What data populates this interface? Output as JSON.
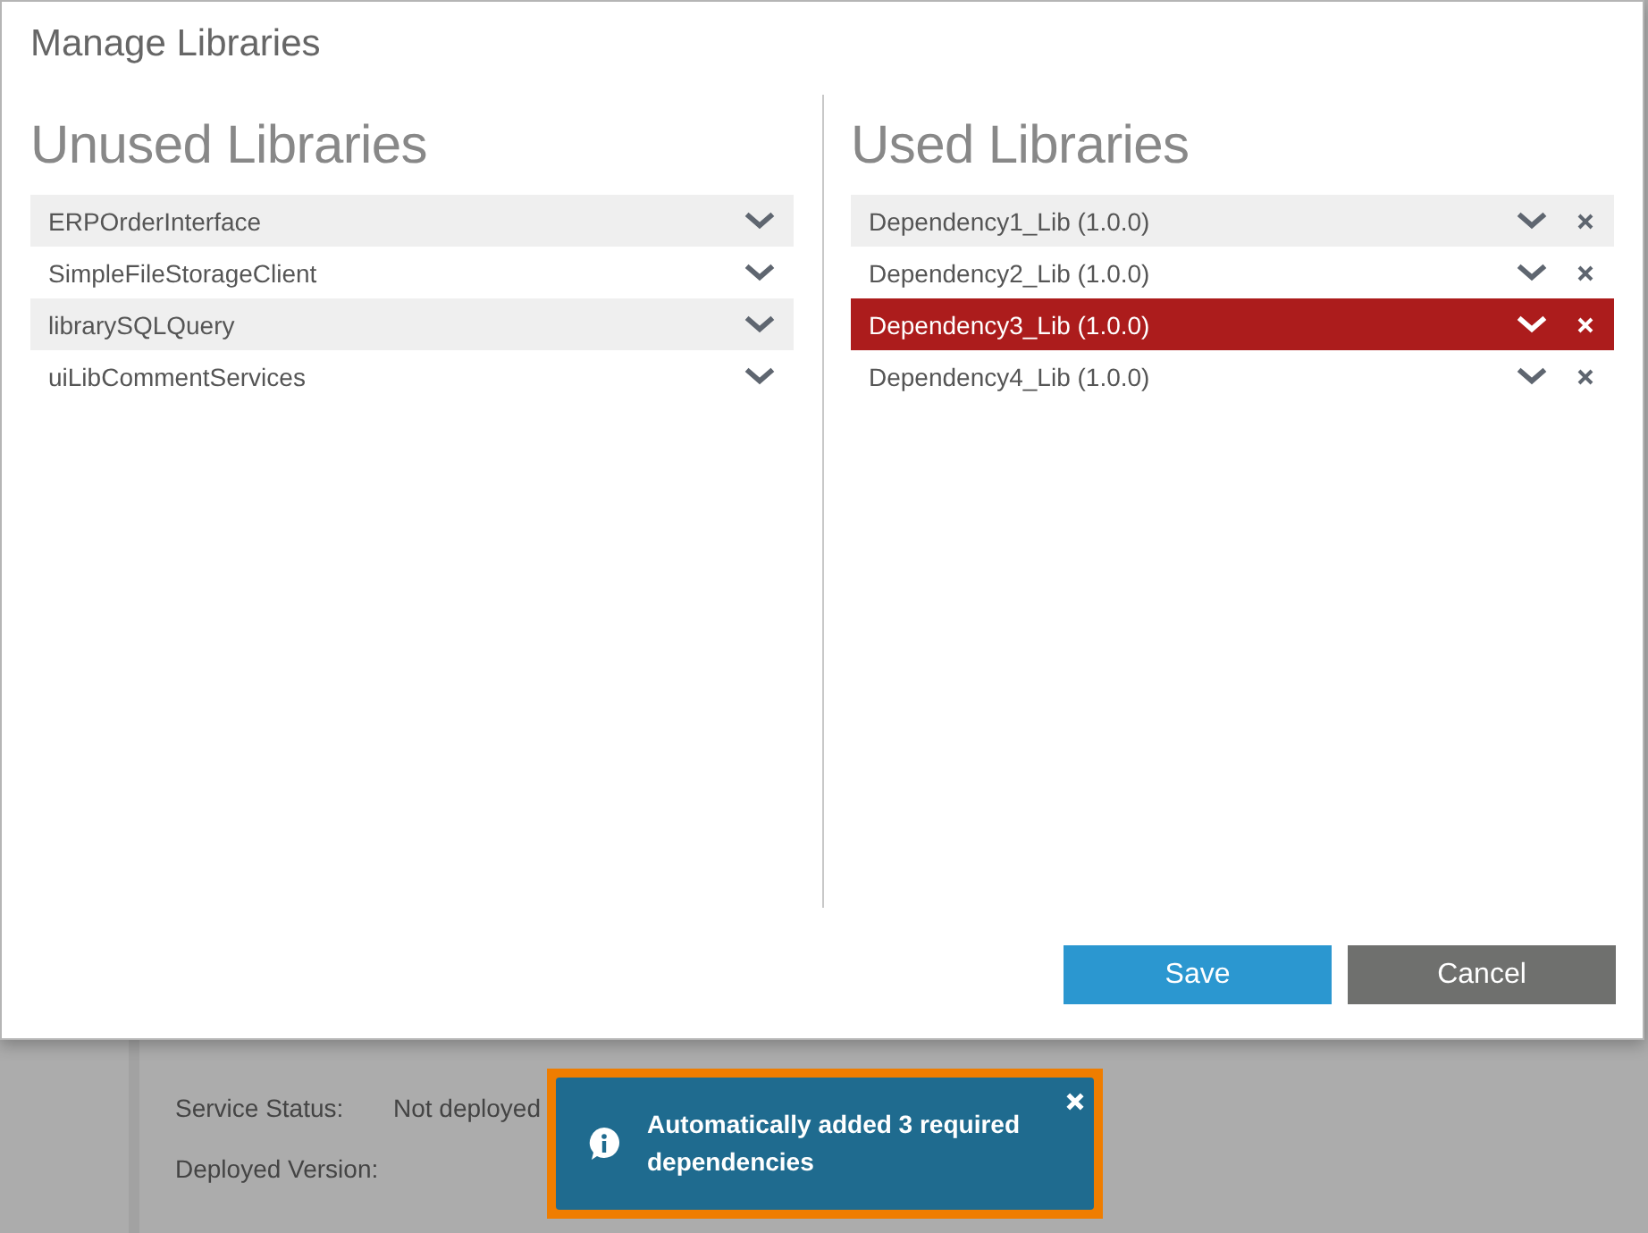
{
  "background": {
    "fields": [
      {
        "label": "Service Status:",
        "value": "Not deployed"
      },
      {
        "label": "Deployed Version:"
      }
    ]
  },
  "dialog": {
    "title": "Manage Libraries",
    "unused": {
      "heading": "Unused Libraries",
      "items": [
        {
          "name": "ERPOrderInterface",
          "selected": false
        },
        {
          "name": "SimpleFileStorageClient",
          "selected": false
        },
        {
          "name": "librarySQLQuery",
          "selected": false
        },
        {
          "name": "uiLibCommentServices",
          "selected": false
        }
      ]
    },
    "used": {
      "heading": "Used Libraries",
      "items": [
        {
          "name": "Dependency1_Lib (1.0.0)",
          "selected": false
        },
        {
          "name": "Dependency2_Lib (1.0.0)",
          "selected": false
        },
        {
          "name": "Dependency3_Lib (1.0.0)",
          "selected": true
        },
        {
          "name": "Dependency4_Lib (1.0.0)",
          "selected": false
        }
      ]
    },
    "buttons": [
      {
        "label": "Save",
        "kind": "primary"
      },
      {
        "label": "Cancel",
        "kind": "secondary"
      }
    ]
  },
  "toast": {
    "message": "Automatically added 3 required dependencies"
  }
}
